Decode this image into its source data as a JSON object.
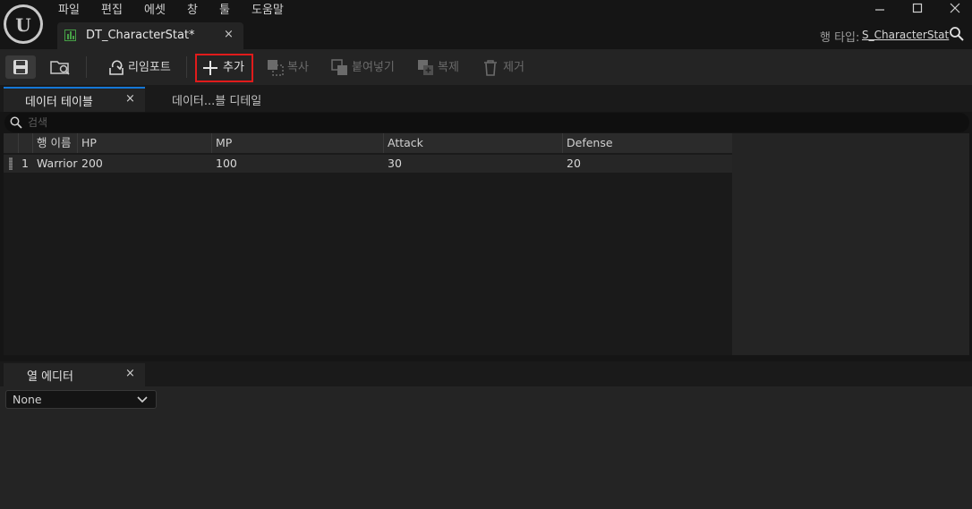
{
  "menu": [
    "파일",
    "편집",
    "에셋",
    "창",
    "툴",
    "도움말"
  ],
  "window_controls": {
    "minimize": "—",
    "maximize": "☐",
    "close": "✕"
  },
  "doc_tab": {
    "title": "DT_CharacterStat*",
    "close": "×",
    "icon": "datatable-icon"
  },
  "row_type": {
    "label": "행 타입:",
    "value": "S_CharacterStat"
  },
  "toolbar": {
    "save_icon": "save-icon",
    "browse_icon": "browse-icon",
    "reimport": "리임포트",
    "add": "추가",
    "copy": "복사",
    "paste": "붙여넣기",
    "duplicate": "복제",
    "remove": "제거"
  },
  "panel_tabs": {
    "data_table": "데이터 테이블",
    "data_table_close": "×",
    "details": "데이터...블 디테일"
  },
  "search": {
    "placeholder": "검색"
  },
  "table": {
    "columns": [
      "",
      "행 이름",
      "HP",
      "MP",
      "Attack",
      "Defense"
    ],
    "rows": [
      {
        "index": "1",
        "name": "Warrior",
        "HP": "200",
        "MP": "100",
        "Attack": "30",
        "Defense": "20"
      }
    ]
  },
  "column_editor": {
    "tab": "열 에디터",
    "close": "×",
    "selected": "None"
  },
  "colors": {
    "accent_blue": "#1477d6",
    "highlight_red": "#e01b1b",
    "datatable_green": "#46a046"
  }
}
